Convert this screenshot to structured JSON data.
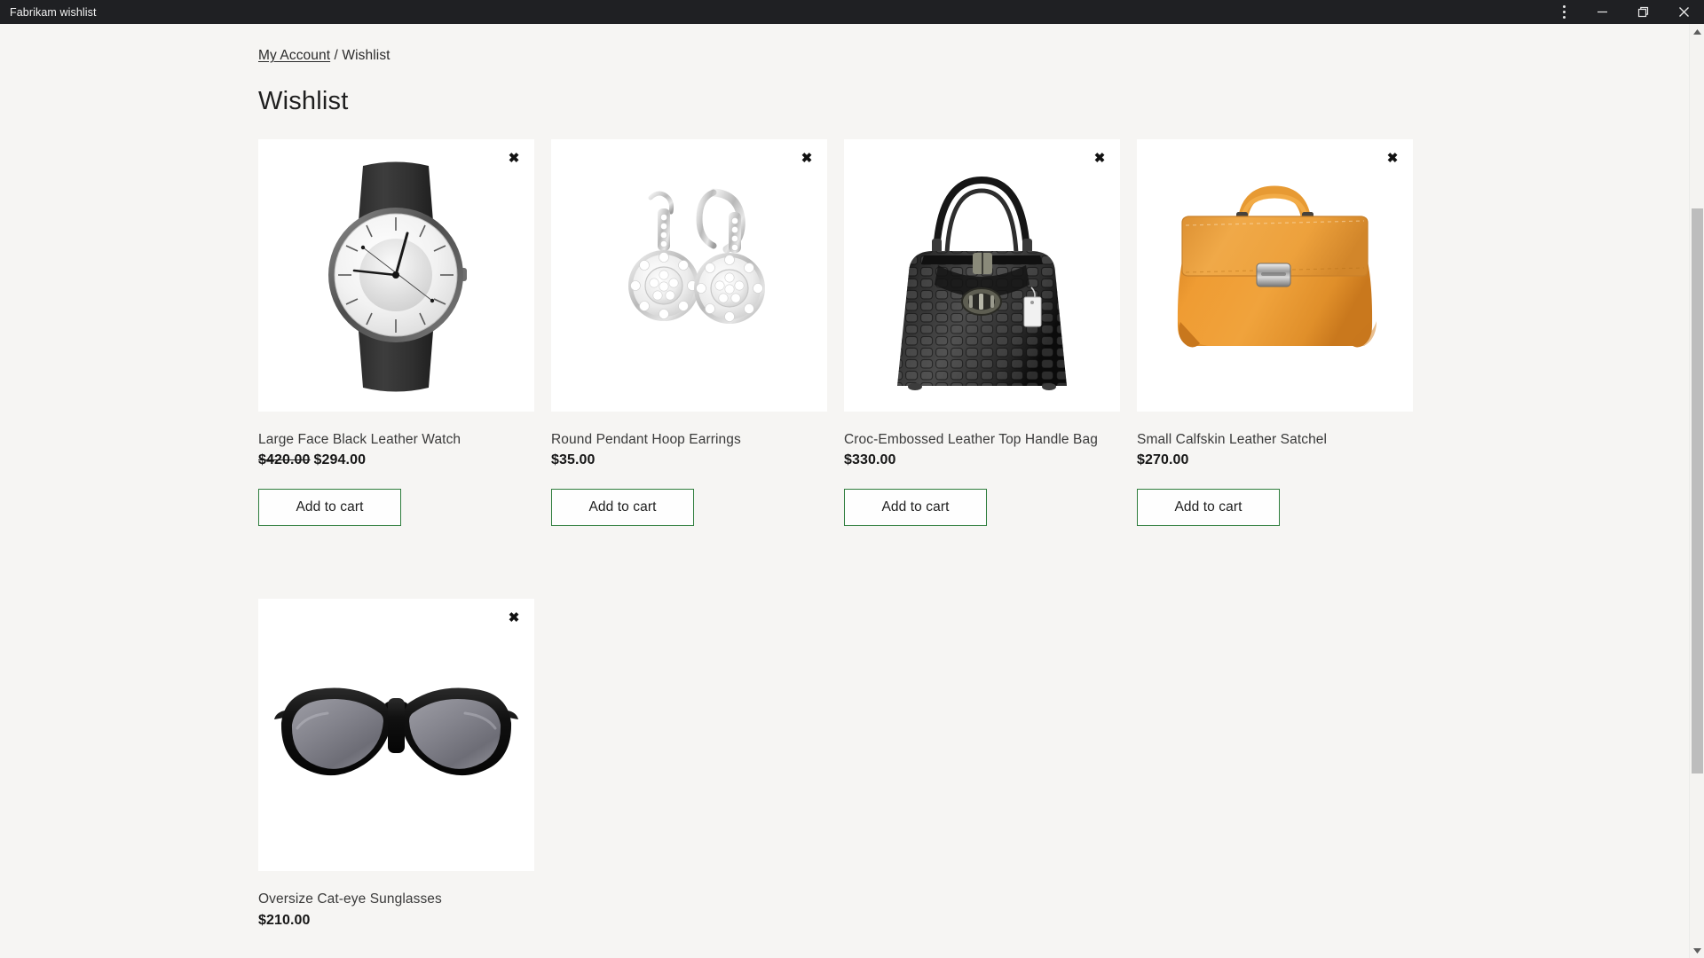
{
  "window": {
    "title": "Fabrikam wishlist",
    "controls": {
      "menu": "more-options",
      "minimize": "minimize",
      "maximize": "restore",
      "close": "close"
    }
  },
  "breadcrumb": {
    "parent": "My Account",
    "separator": "/",
    "current": "Wishlist"
  },
  "page": {
    "title": "Wishlist"
  },
  "labels": {
    "add_to_cart": "Add to cart",
    "remove": "✖"
  },
  "colors": {
    "page_background": "#f6f5f3",
    "card_background": "#ffffff",
    "titlebar": "#1f2023",
    "button_border_green": "#2e7d3c",
    "text_primary": "#1f1f1f",
    "text_secondary": "#3a3a3a",
    "scrollbar_thumb": "#bdbdbd"
  },
  "products": [
    {
      "name": "Large Face Black Leather Watch",
      "price": "$294.00",
      "original_price": "$420.00",
      "on_sale": true,
      "image": "black-leather-watch-image",
      "add_to_cart": "Add to cart",
      "remove_label": "✖"
    },
    {
      "name": "Round Pendant Hoop Earrings",
      "price": "$35.00",
      "original_price": "",
      "on_sale": false,
      "image": "pendant-hoop-earrings-image",
      "add_to_cart": "Add to cart",
      "remove_label": "✖"
    },
    {
      "name": "Croc-Embossed Leather Top Handle Bag",
      "price": "$330.00",
      "original_price": "",
      "on_sale": false,
      "image": "croc-embossed-handbag-image",
      "add_to_cart": "Add to cart",
      "remove_label": "✖"
    },
    {
      "name": "Small Calfskin Leather Satchel",
      "price": "$270.00",
      "original_price": "",
      "on_sale": false,
      "image": "calfskin-satchel-image",
      "add_to_cart": "Add to cart",
      "remove_label": "✖"
    },
    {
      "name": "Oversize Cat-eye Sunglasses",
      "price": "$210.00",
      "original_price": "",
      "on_sale": false,
      "image": "cat-eye-sunglasses-image",
      "add_to_cart": "",
      "remove_label": "✖"
    }
  ]
}
